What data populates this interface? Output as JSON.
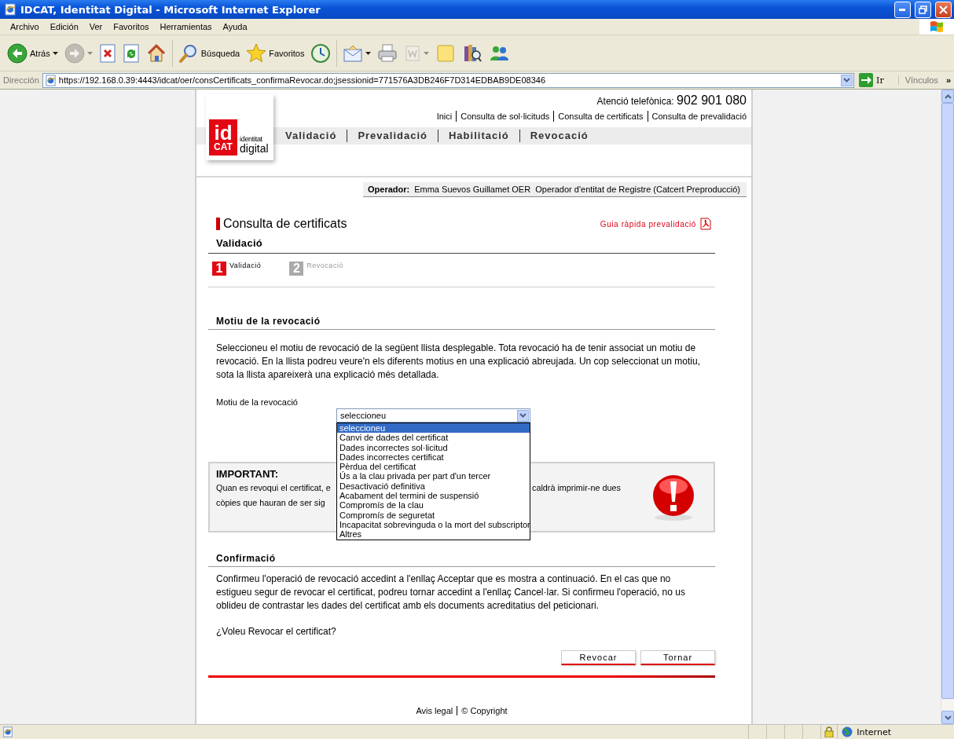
{
  "window": {
    "title": "IDCAT, Identitat Digital - Microsoft Internet Explorer"
  },
  "menu": [
    "Archivo",
    "Edición",
    "Ver",
    "Favoritos",
    "Herramientas",
    "Ayuda"
  ],
  "toolbar": {
    "groups": [
      [
        {
          "kind": "back",
          "label": "Atrás",
          "menu_arrow": true,
          "disabled": false
        },
        {
          "kind": "forward",
          "menu_arrow": true,
          "disabled": true
        },
        {
          "kind": "stop",
          "menu_arrow": false,
          "disabled": false
        },
        {
          "kind": "refresh",
          "menu_arrow": false,
          "disabled": false
        },
        {
          "kind": "home",
          "menu_arrow": false,
          "disabled": false
        }
      ],
      [
        {
          "kind": "search",
          "label": "Búsqueda",
          "menu_arrow": false,
          "disabled": false
        },
        {
          "kind": "favorites",
          "label": "Favoritos",
          "menu_arrow": false,
          "disabled": false
        },
        {
          "kind": "history",
          "menu_arrow": false,
          "disabled": false
        }
      ],
      [
        {
          "kind": "mail",
          "menu_arrow": true,
          "disabled": false
        },
        {
          "kind": "print",
          "menu_arrow": false,
          "disabled": false
        },
        {
          "kind": "edit",
          "menu_arrow": true,
          "disabled": true
        },
        {
          "kind": "notes",
          "menu_arrow": false,
          "disabled": false
        },
        {
          "kind": "research",
          "menu_arrow": false,
          "disabled": false
        },
        {
          "kind": "messenger",
          "menu_arrow": false,
          "disabled": false
        }
      ]
    ]
  },
  "address": {
    "label": "Dirección",
    "value": "https://192.168.0.39:4443/idcat/oer/consCertificats_confirmaRevocar.do;jsessionid=771576A3DB246F7D314EDBAB9DE08346",
    "go": "Ir",
    "links": "Vínculos",
    "more": "»"
  },
  "page": {
    "logo": {
      "mark_top": "id",
      "mark_bottom": "CAT",
      "text_top": "identitat",
      "text_bottom": "digital"
    },
    "phone_label": "Atenció telefònica:",
    "phone": "902 901 080",
    "top_links": [
      "Inici",
      "Consulta de sol·licituds",
      "Consulta de certificats",
      "Consulta de prevalidació"
    ],
    "nav": [
      "Validació",
      "Prevalidació",
      "Habilitació",
      "Revocació"
    ],
    "operator": {
      "label": "Operador:",
      "name": "Emma Suevos Guillamet OER",
      "role": "Operador d'entitat de Registre (Catcert Preproducció)"
    },
    "title": "Consulta de certificats",
    "guide_link": "Guia ràpida prevalidació",
    "subtitle": "Validació",
    "steps": [
      {
        "number": "1",
        "label": "Validació",
        "selected": true
      },
      {
        "number": "2",
        "label": "Revocació",
        "selected": false
      }
    ],
    "reason": {
      "heading": "Motiu de la revocació",
      "paragraph": "Seleccioneu el motiu de revocació de la següent llista desplegable. Tota revocació ha de tenir associat un motiu de revocació. En la llista podreu veure'n els diferents motius en una explicació abreujada. Un cop seleccionat un motiu, sota la llista apareixerà una explicació més detallada.",
      "field_label": "Motiu de la revocació",
      "select": {
        "value": "seleccioneu",
        "expanded": true,
        "options": [
          {
            "label": "seleccioneu",
            "selected": true
          },
          {
            "label": "Canvi de dades del certificat",
            "selected": false
          },
          {
            "label": "Dades incorrectes sol·licitud",
            "selected": false
          },
          {
            "label": "Dades incorrectes certificat",
            "selected": false
          },
          {
            "label": "Pèrdua del certificat",
            "selected": false
          },
          {
            "label": "Ús a la clau privada per part d'un tercer",
            "selected": false
          },
          {
            "label": "Desactivació definitiva",
            "selected": false
          },
          {
            "label": "Acabament del termini de suspensió",
            "selected": false
          },
          {
            "label": "Compromís de la clau",
            "selected": false
          },
          {
            "label": "Compromís de seguretat",
            "selected": false
          },
          {
            "label": "Incapacitat sobrevinguda o la mort del subscriptor",
            "selected": false
          },
          {
            "label": "Altres",
            "selected": false
          }
        ]
      }
    },
    "important": {
      "title": "IMPORTANT:",
      "line_1_before": "Quan es revoqui el certificat, e",
      "line_1_after": "caldrà imprimir-ne dues",
      "line_2_before": "còpies que hauran de ser sig"
    },
    "confirm": {
      "heading": "Confirmació",
      "paragraph": "Confirmeu l'operació de revocació accedint a l'enllaç Acceptar que es mostra a continuació. En el cas que no estigueu segur de revocar el certificat, podreu tornar accedint a l'enllaç Cancel·lar. Si confirmeu l'operació, no us oblideu de contrastar les dades del certificat amb els documents acreditatius del peticionari.",
      "question": "¿Voleu Revocar el certificat?",
      "buttons": [
        "Revocar",
        "Tornar"
      ]
    },
    "footer": [
      "Avis legal",
      "© Copyright"
    ]
  },
  "status_bar": {
    "zone": "Internet"
  }
}
